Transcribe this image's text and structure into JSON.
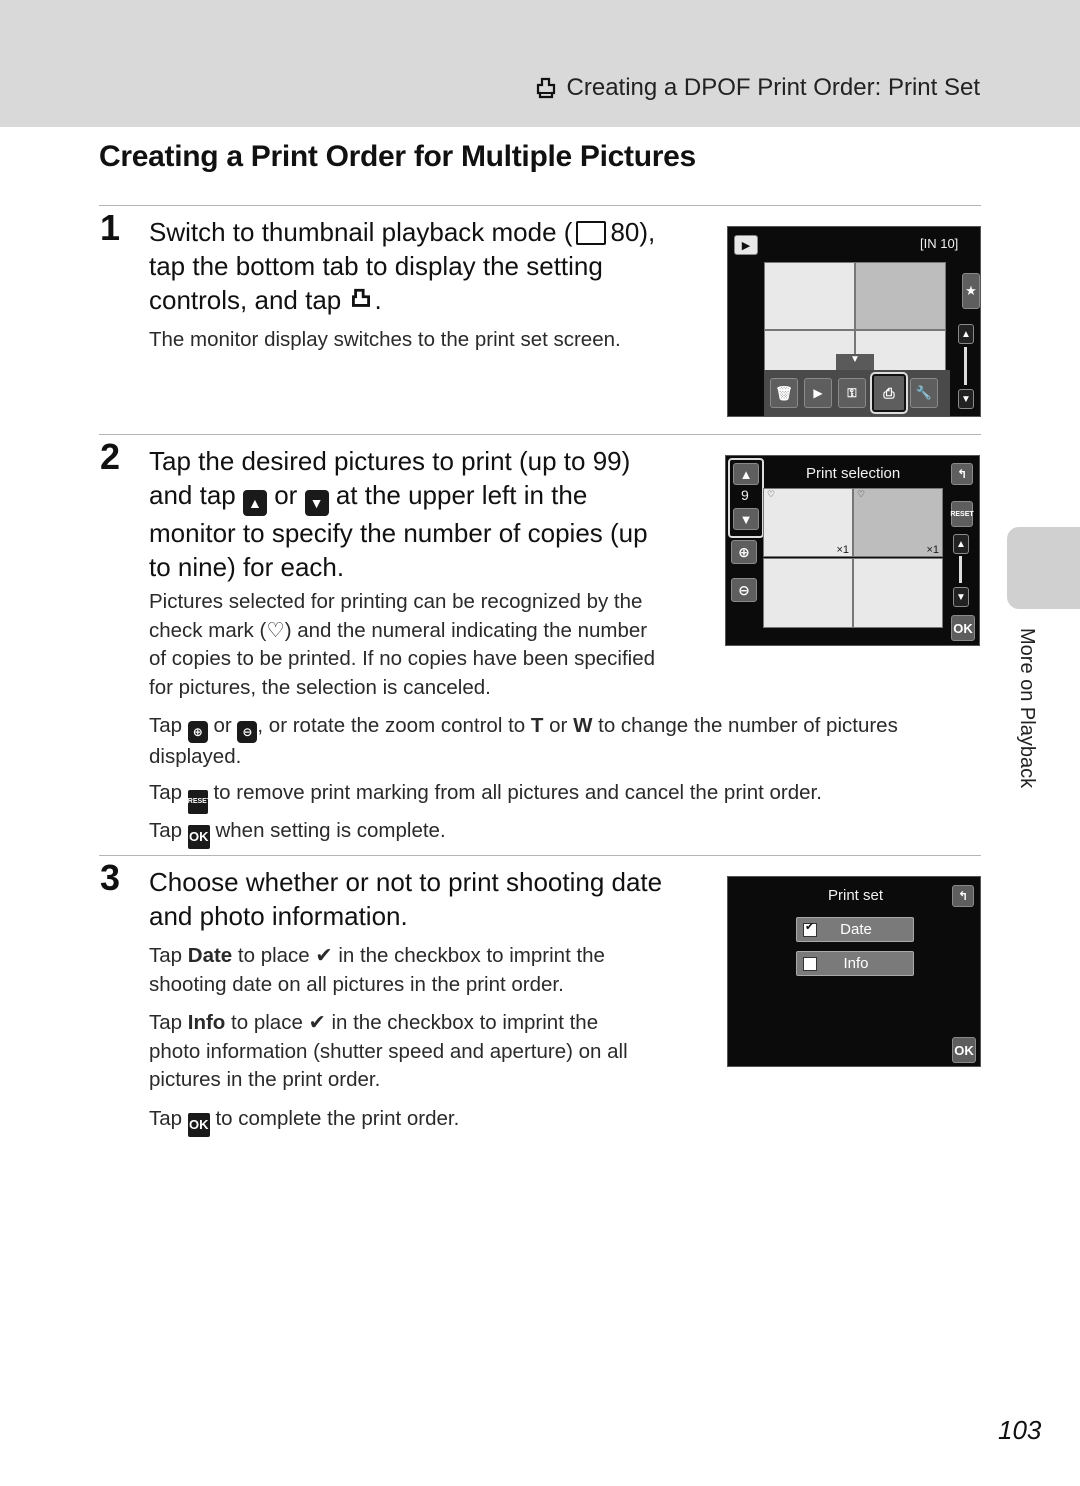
{
  "running_head": {
    "icon": "print-icon",
    "text": "Creating a DPOF Print Order: Print Set"
  },
  "page_title": "Creating a Print Order for Multiple Pictures",
  "steps": [
    {
      "number": "1",
      "heading_parts": [
        "Switch to thumbnail playback mode (",
        "80),",
        "tap the bottom tab to display the setting",
        "controls, and tap",
        "."
      ],
      "body": "The monitor display switches to the print set screen."
    },
    {
      "number": "2",
      "heading_parts": [
        "Tap the desired pictures to print (up to 99)",
        "and tap",
        "or",
        "at the upper left in the",
        "monitor to specify the number of copies (up",
        "to nine) for each."
      ],
      "body_lines": [
        "Pictures selected for printing can be recognized by the",
        "check mark (",
        ") and the numeral indicating the number",
        "of copies to be printed. If no copies have been specified",
        "for pictures, the selection is canceled."
      ],
      "zoom_note": {
        "p1": "Tap",
        "p2": "or",
        "p3": ", or rotate the zoom control to",
        "t": "T",
        "p4": "or",
        "w": "W",
        "p5": "to change the number of pictures",
        "p6": "displayed."
      },
      "reset_note": {
        "p1": "Tap",
        "p2": "to remove print marking from all pictures and cancel the print order."
      },
      "ok_note": {
        "p1": "Tap",
        "p2": "when setting is complete."
      }
    },
    {
      "number": "3",
      "heading_lines": [
        "Choose whether or not to print shooting date",
        "and photo information."
      ],
      "date_note": {
        "p1": "Tap",
        "bold": "Date",
        "p2": "to place",
        "p3": "in the checkbox to imprint the",
        "p4": "shooting date on all pictures in the print order."
      },
      "info_note": {
        "p1": "Tap",
        "bold": "Info",
        "p2": "to place",
        "p3": "in the checkbox to imprint the",
        "p4": "photo information (shutter speed and aperture) on all",
        "p5": "pictures in the print order."
      },
      "ok_note": {
        "p1": "Tap",
        "p2": "to complete the print order."
      }
    }
  ],
  "screens": {
    "thumbnail": {
      "memory_indicator": "[IN 10]",
      "toolbar_icons": [
        "delete-icon",
        "slideshow-icon",
        "protect-icon",
        "print-icon",
        "setup-icon"
      ],
      "selected_tool": "print-icon"
    },
    "print_selection": {
      "title": "Print selection",
      "copies": "9",
      "marks": [
        "×1",
        "×1"
      ],
      "reset_label": "RESET",
      "ok_label": "OK"
    },
    "print_set": {
      "title": "Print set",
      "options": [
        {
          "label": "Date",
          "checked": true
        },
        {
          "label": "Info",
          "checked": false
        }
      ],
      "ok_label": "OK"
    }
  },
  "ok_label": "OK",
  "side_tab": "More on Playback",
  "page_number": "103"
}
